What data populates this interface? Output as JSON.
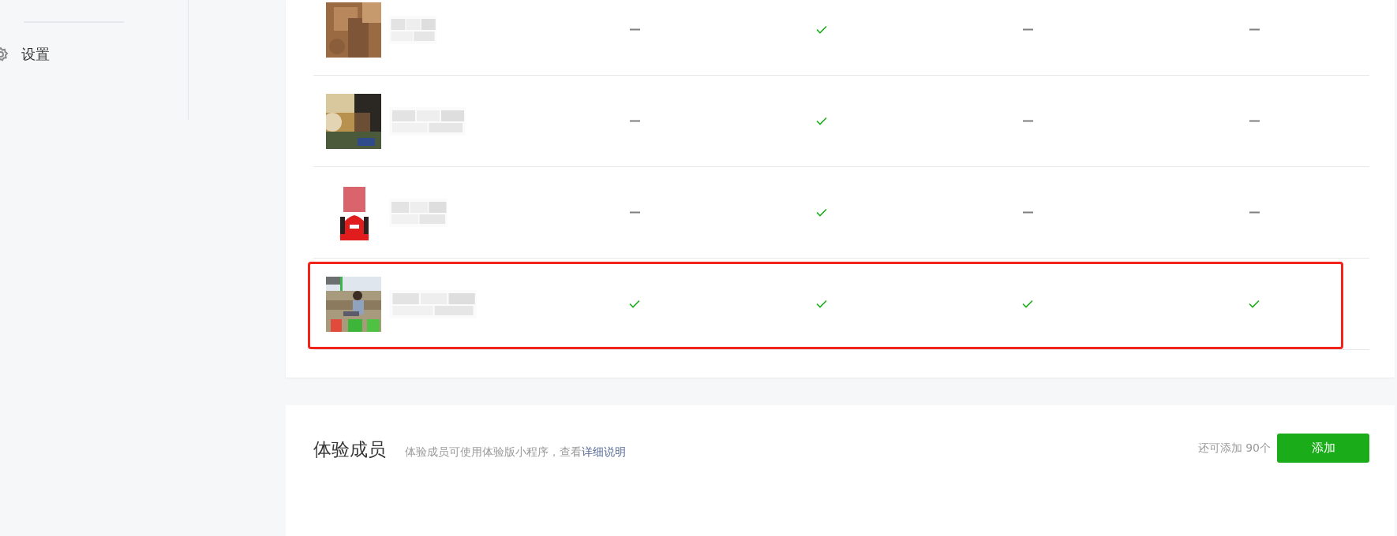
{
  "sidebar": {
    "items": [
      {
        "label": "设置",
        "selected": false
      }
    ]
  },
  "members_table": {
    "rows": [
      {
        "highlighted": false,
        "permissions": [
          {
            "granted": false
          },
          {
            "granted": true
          },
          {
            "granted": false
          },
          {
            "granted": false
          }
        ]
      },
      {
        "highlighted": false,
        "permissions": [
          {
            "granted": false
          },
          {
            "granted": true
          },
          {
            "granted": false
          },
          {
            "granted": false
          }
        ]
      },
      {
        "highlighted": false,
        "permissions": [
          {
            "granted": false
          },
          {
            "granted": true
          },
          {
            "granted": false
          },
          {
            "granted": false
          }
        ]
      },
      {
        "highlighted": true,
        "permissions": [
          {
            "granted": true
          },
          {
            "granted": true
          },
          {
            "granted": true
          },
          {
            "granted": true
          }
        ]
      }
    ]
  },
  "testers_section": {
    "title": "体验成员",
    "description": "体验成员可使用体验版小程序，查看",
    "link": "详细说明",
    "remaining": "还可添加 90个",
    "add_button": "添加"
  }
}
